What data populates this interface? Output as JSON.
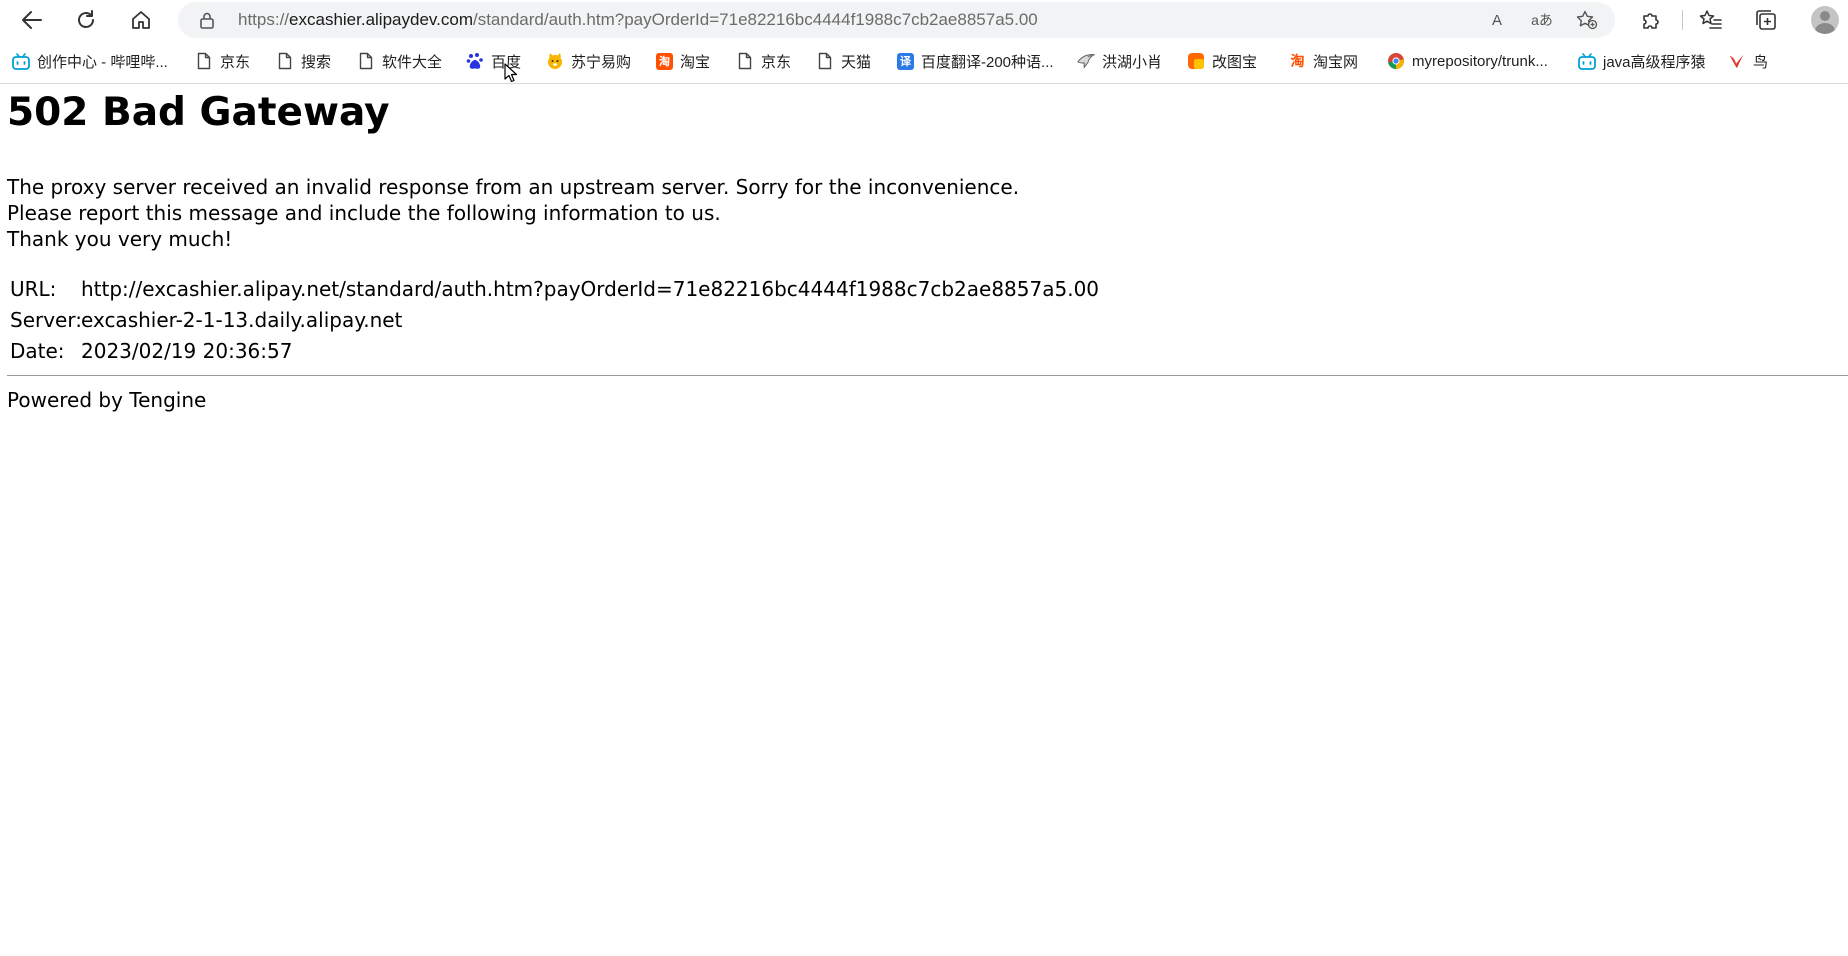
{
  "browser": {
    "address": {
      "scheme": "https://",
      "host": "excashier.alipaydev.com",
      "path": "/standard/auth.htm?payOrderId=71e82216bc4444f1988c7cb2ae8857a5.00"
    },
    "read_aloud_label": "A",
    "translate_label": "aあ",
    "bookmarks": [
      {
        "label": "创作中心 - 哔哩哔...",
        "icon": "bilibili-icon"
      },
      {
        "label": "京东",
        "icon": "page-icon"
      },
      {
        "label": "搜索",
        "icon": "page-icon"
      },
      {
        "label": "软件大全",
        "icon": "page-icon"
      },
      {
        "label": "百度",
        "icon": "baidu-icon"
      },
      {
        "label": "苏宁易购",
        "icon": "suning-icon"
      },
      {
        "label": "淘宝",
        "icon": "taobao-icon"
      },
      {
        "label": "京东",
        "icon": "page-icon"
      },
      {
        "label": "天猫",
        "icon": "page-icon"
      },
      {
        "label": "百度翻译-200种语...",
        "icon": "baidu-translate-icon"
      },
      {
        "label": "洪湖小肖",
        "icon": "eagle-icon"
      },
      {
        "label": "改图宝",
        "icon": "gaitubao-icon"
      },
      {
        "label": "淘宝网",
        "icon": "taobao-icon"
      },
      {
        "label": "myrepository/trunk...",
        "icon": "chrome-icon"
      },
      {
        "label": "java高级程序猿",
        "icon": "bilibili-icon"
      },
      {
        "label": "鸟",
        "icon": "bird-icon"
      }
    ],
    "icons": {
      "fav_translate_glyph": "译",
      "fav_taobao_glyph": "淘",
      "fav_taobao_color": "#ff5000",
      "fav_translate_color": "#2b7be6",
      "fav_bilibili_color": "#00a1d6",
      "fav_gaitubao_color": "#ff6a00",
      "fav_bird_color": "#e23a2e"
    }
  },
  "page": {
    "heading": "502 Bad Gateway",
    "message_lines": [
      "The proxy server received an invalid response from an upstream server. Sorry for the inconvenience.",
      "Please report this message and include the following information to us.",
      "Thank you very much!"
    ],
    "info": [
      {
        "key": "URL:",
        "value": "http://excashier.alipay.net/standard/auth.htm?payOrderId=71e82216bc4444f1988c7cb2ae8857a5.00"
      },
      {
        "key": "Server:",
        "value": "excashier-2-1-13.daily.alipay.net"
      },
      {
        "key": "Date:",
        "value": "2023/02/19 20:36:57"
      }
    ],
    "footer": "Powered by Tengine"
  }
}
